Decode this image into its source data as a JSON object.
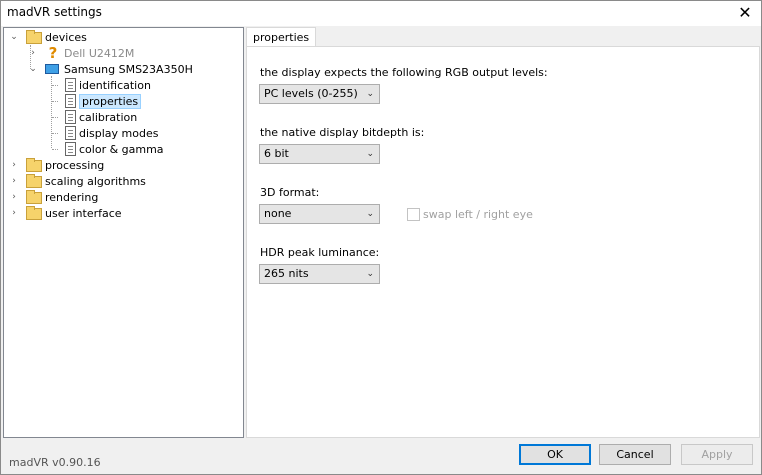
{
  "window": {
    "title": "madVR settings"
  },
  "tree": {
    "devices_label": "devices",
    "dell_label": "Dell U2412M",
    "samsung_label": "Samsung SMS23A350H",
    "sub_items": [
      "identification",
      "properties",
      "calibration",
      "display modes",
      "color & gamma"
    ],
    "top_items": [
      "processing",
      "scaling algorithms",
      "rendering",
      "user interface"
    ]
  },
  "tab": {
    "label": "properties"
  },
  "settings": {
    "rgb_label": "the display expects the following RGB output levels:",
    "rgb_value": "PC levels (0-255)",
    "bitdepth_label": "the native display bitdepth is:",
    "bitdepth_value": "6 bit",
    "format3d_label": "3D format:",
    "format3d_value": "none",
    "swap_label": "swap left / right eye",
    "hdr_label": "HDR peak luminance:",
    "hdr_value": "265 nits"
  },
  "footer": {
    "version": "madVR v0.90.16",
    "ok": "OK",
    "cancel": "Cancel",
    "apply": "Apply"
  }
}
